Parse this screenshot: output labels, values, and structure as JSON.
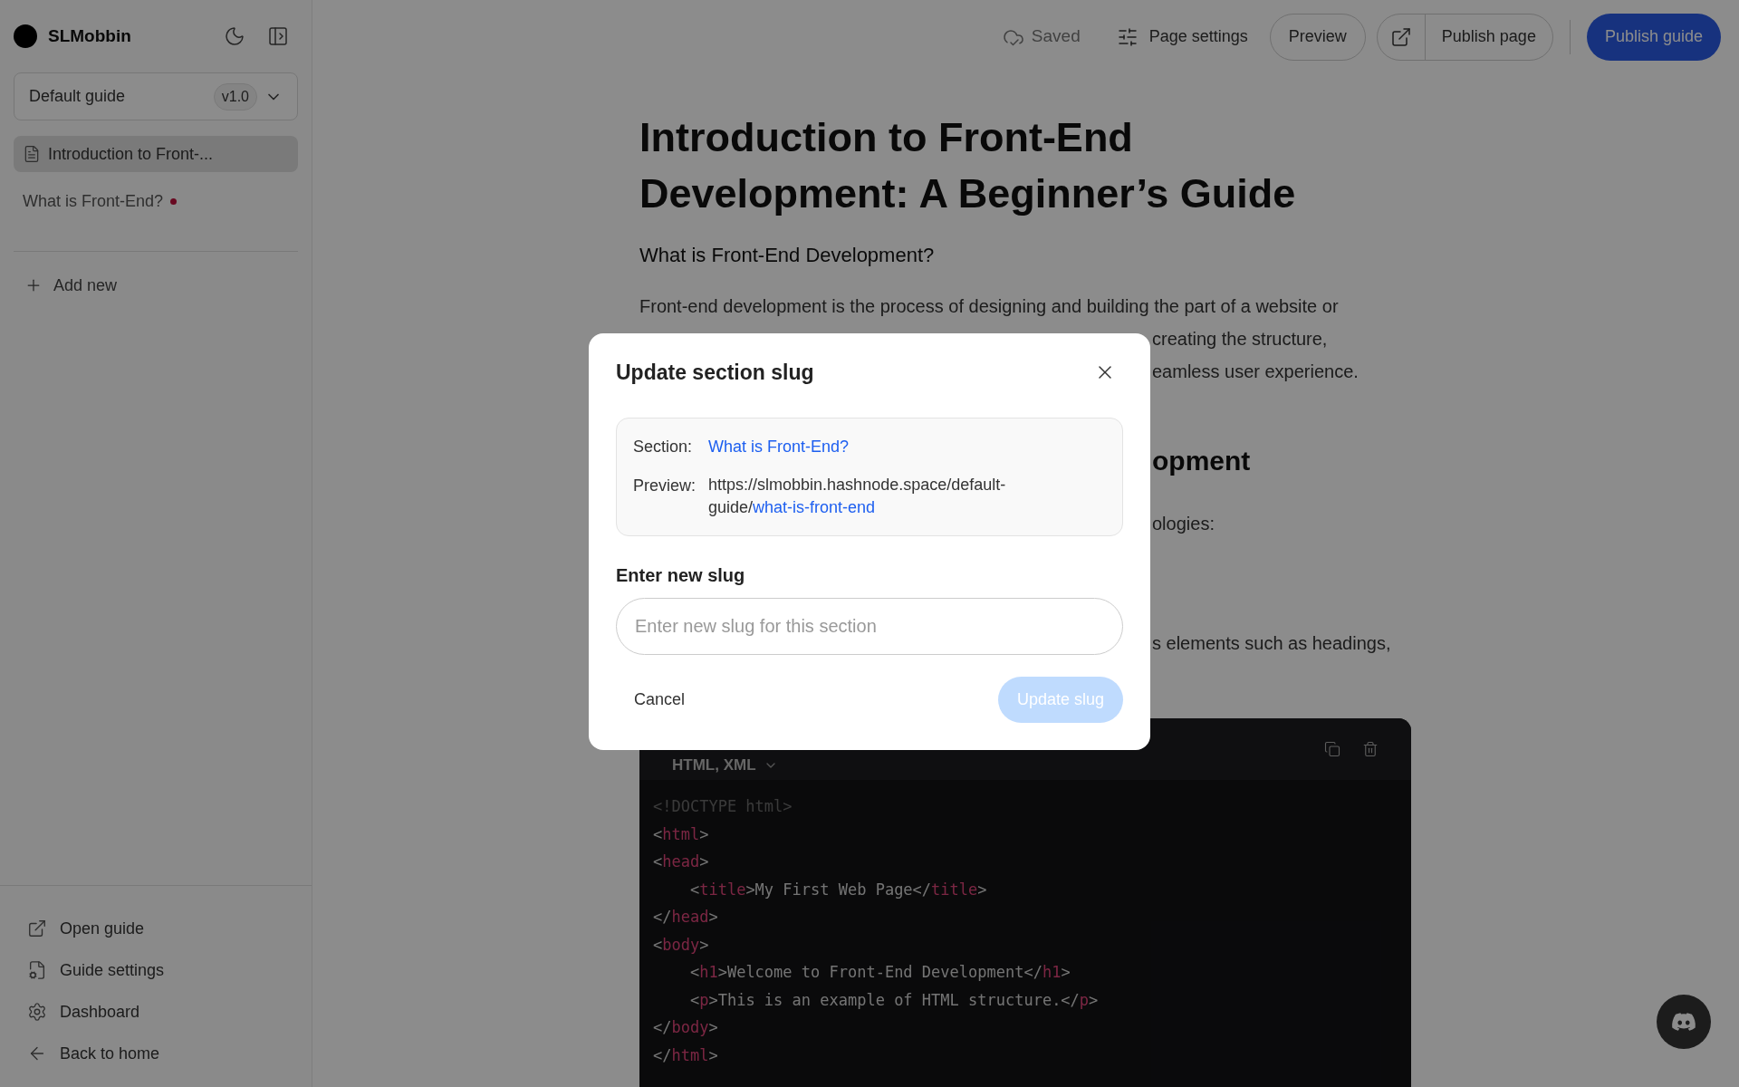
{
  "sidebar": {
    "brand": "SLMobbin",
    "guide_select": {
      "value": "Default guide",
      "version": "v1.0"
    },
    "pages": [
      {
        "label": "Introduction to Front-...",
        "kind": "page",
        "selected": true,
        "modified": false
      },
      {
        "label": "What is Front-End?",
        "kind": "section",
        "selected": false,
        "modified": true
      }
    ],
    "add_new": "Add new",
    "footer_links": [
      {
        "label": "Open guide"
      },
      {
        "label": "Guide settings"
      },
      {
        "label": "Dashboard"
      },
      {
        "label": "Back to home"
      }
    ]
  },
  "toolbar": {
    "status": "Saved",
    "page_settings": "Page settings",
    "preview": "Preview",
    "publish_page": "Publish page",
    "publish_guide": "Publish guide"
  },
  "article": {
    "title": "Introduction to Front-End Development: A Beginner’s Guide",
    "subtitle": "What is Front-End Development?",
    "paragraph_first_line": "Front-end development is the process of designing and building the part of a website or",
    "visible_fragments": [
      {
        "kind": "text",
        "text": "creating the structure,"
      },
      {
        "kind": "text",
        "text": "eamless user experience."
      },
      {
        "kind": "gap"
      },
      {
        "kind": "heading",
        "text": "opment"
      },
      {
        "kind": "text",
        "text": "ologies:"
      },
      {
        "kind": "gap"
      },
      {
        "kind": "gap"
      },
      {
        "kind": "text",
        "text": "s elements such as headings,"
      }
    ],
    "code_block": {
      "language": "HTML, XML",
      "lines": [
        [
          {
            "kind": "doctype",
            "text": "<!DOCTYPE html>"
          }
        ],
        [
          {
            "kind": "punct",
            "text": "<"
          },
          {
            "kind": "tag",
            "text": "html"
          },
          {
            "kind": "punct",
            "text": ">"
          }
        ],
        [
          {
            "kind": "punct",
            "text": "<"
          },
          {
            "kind": "tag",
            "text": "head"
          },
          {
            "kind": "punct",
            "text": ">"
          }
        ],
        [
          {
            "kind": "punct",
            "text": "    <"
          },
          {
            "kind": "tag",
            "text": "title"
          },
          {
            "kind": "punct",
            "text": ">My First Web Page</"
          },
          {
            "kind": "tag",
            "text": "title"
          },
          {
            "kind": "punct",
            "text": ">"
          }
        ],
        [
          {
            "kind": "punct",
            "text": "</"
          },
          {
            "kind": "tag",
            "text": "head"
          },
          {
            "kind": "punct",
            "text": ">"
          }
        ],
        [
          {
            "kind": "punct",
            "text": "<"
          },
          {
            "kind": "tag",
            "text": "body"
          },
          {
            "kind": "punct",
            "text": ">"
          }
        ],
        [
          {
            "kind": "punct",
            "text": "    <"
          },
          {
            "kind": "tag",
            "text": "h1"
          },
          {
            "kind": "punct",
            "text": ">Welcome to Front-End Development</"
          },
          {
            "kind": "tag",
            "text": "h1"
          },
          {
            "kind": "punct",
            "text": ">"
          }
        ],
        [
          {
            "kind": "punct",
            "text": "    <"
          },
          {
            "kind": "tag",
            "text": "p"
          },
          {
            "kind": "punct",
            "text": ">This is an example of HTML structure.</"
          },
          {
            "kind": "tag",
            "text": "p"
          },
          {
            "kind": "punct",
            "text": ">"
          }
        ],
        [
          {
            "kind": "punct",
            "text": "</"
          },
          {
            "kind": "tag",
            "text": "body"
          },
          {
            "kind": "punct",
            "text": ">"
          }
        ],
        [
          {
            "kind": "punct",
            "text": "</"
          },
          {
            "kind": "tag",
            "text": "html"
          },
          {
            "kind": "punct",
            "text": ">"
          }
        ]
      ]
    }
  },
  "dialog": {
    "title": "Update section slug",
    "section_label": "Section:",
    "section_value": "What is Front-End?",
    "preview_label": "Preview:",
    "preview_base": "https://slmobbin.hashnode.space/default-guide/",
    "preview_slug": "what-is-front-end",
    "field_label": "Enter new slug",
    "field": {
      "placeholder": "Enter new slug for this section"
    },
    "cancel": "Cancel",
    "submit": {
      "label": "Update slug",
      "disabled": true
    }
  }
}
